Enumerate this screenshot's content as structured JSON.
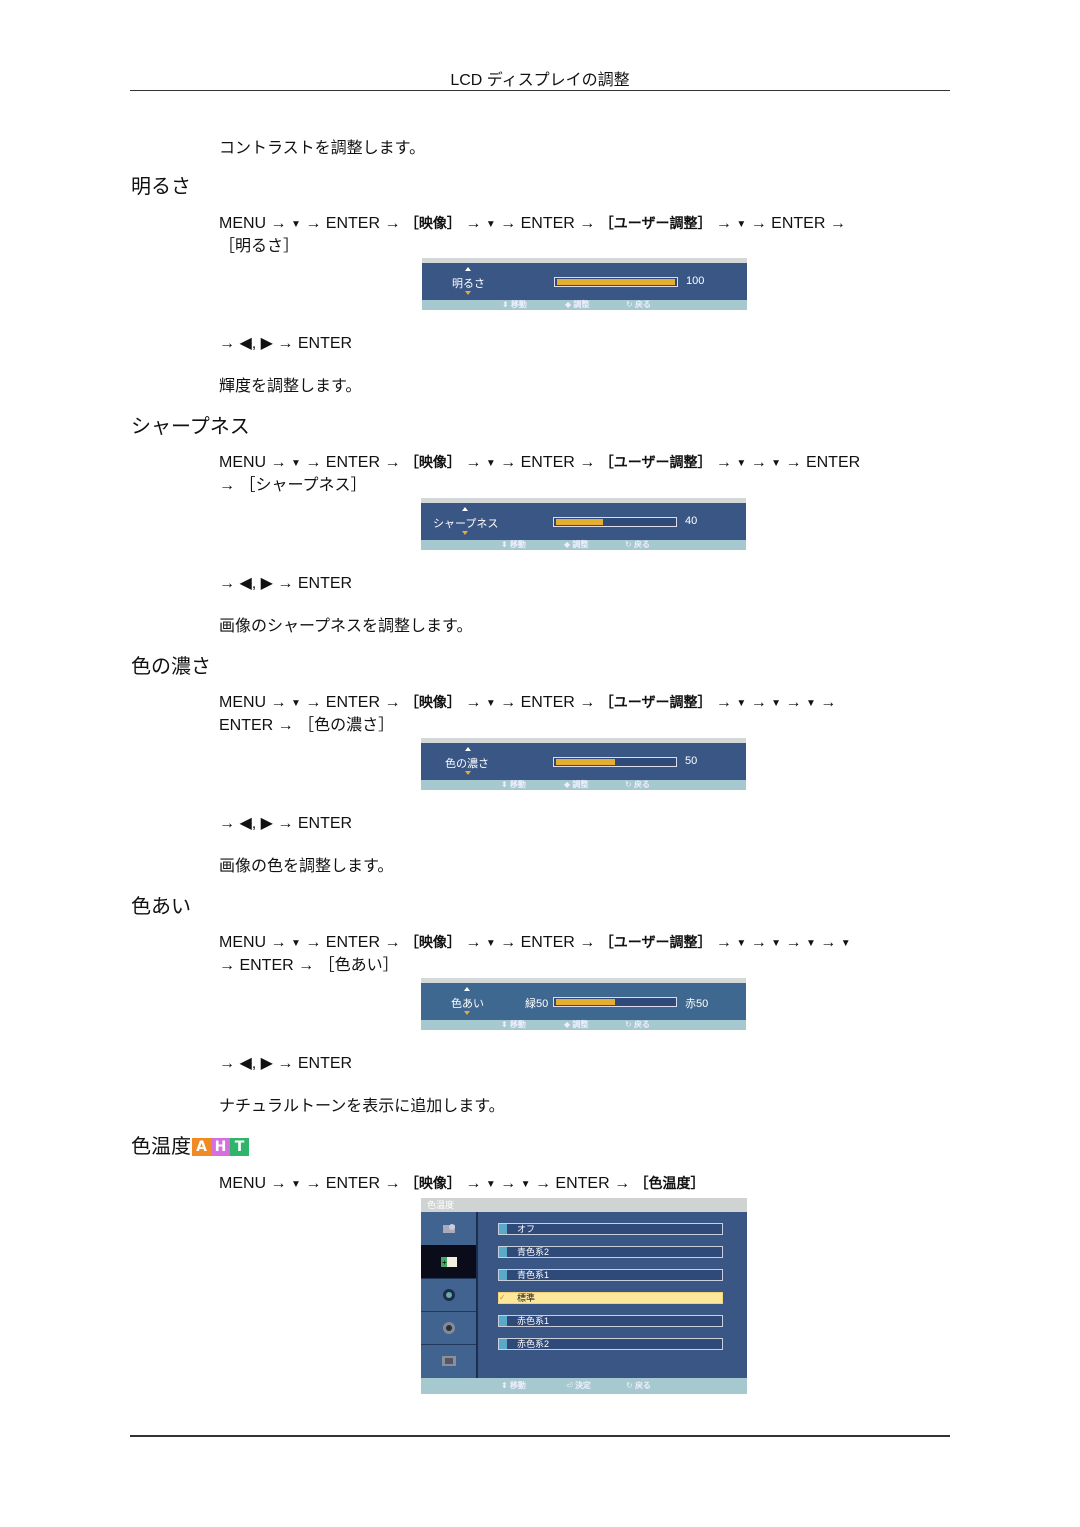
{
  "header": {
    "title": "LCD ディスプレイの調整"
  },
  "intro_text": "コントラストを調整します。",
  "arrows": {
    "right": "→",
    "down": "▼",
    "left_tri": "◀",
    "right_tri": "▶"
  },
  "sections": [
    {
      "title": "明るさ",
      "path_line1": [
        "MENU",
        "▼",
        "ENTER",
        "［映像］",
        "▼",
        "ENTER",
        "［ユーザー調整］",
        "▼",
        "ENTER"
      ],
      "path_line2_text": "［明るさ］",
      "osd": {
        "label": "明るさ",
        "value": "100",
        "fill_percent": 100
      },
      "nav": "→ ◀, ▶ → ENTER",
      "description": "輝度を調整します。"
    },
    {
      "title": "シャープネス",
      "path_line1": [
        "MENU",
        "▼",
        "ENTER",
        "［映像］",
        "▼",
        "ENTER",
        "［ユーザー調整］",
        "▼",
        "▼",
        "ENTER"
      ],
      "path_line2_text": "→ ［シャープネス］",
      "osd": {
        "label": "シャープネス",
        "value": "40",
        "fill_percent": 40
      },
      "nav": "→ ◀, ▶ → ENTER",
      "description": "画像のシャープネスを調整します。"
    },
    {
      "title": "色の濃さ",
      "path_line1": [
        "MENU",
        "▼",
        "ENTER",
        "［映像］",
        "▼",
        "ENTER",
        "［ユーザー調整］",
        "▼",
        "▼",
        "▼"
      ],
      "path_line2_text": "ENTER → ［色の濃さ］",
      "osd": {
        "label": "色の濃さ",
        "value": "50",
        "fill_percent": 50
      },
      "nav": "→ ◀, ▶ → ENTER",
      "description": "画像の色を調整します。"
    },
    {
      "title": "色あい",
      "path_line1": [
        "MENU",
        "▼",
        "ENTER",
        "［映像］",
        "▼",
        "ENTER",
        "［ユーザー調整］",
        "▼",
        "▼",
        "▼",
        "▼"
      ],
      "path_line2_text": "→ ENTER → ［色あい］",
      "osd": {
        "label": "色あい",
        "left_value": "緑50",
        "right_value": "赤50",
        "fill_percent": 50
      },
      "nav": "→ ◀, ▶ → ENTER",
      "description": "ナチュラルトーンを表示に追加します。"
    },
    {
      "title": "色温度",
      "badge": [
        "A",
        "H",
        "T"
      ],
      "badge_colors": [
        "#f08a24",
        "#d66ee0",
        "#2fb56a"
      ],
      "path_line1": [
        "MENU",
        "▼",
        "ENTER",
        "［映像］",
        "▼",
        "▼",
        "ENTER",
        "［色温度］"
      ]
    }
  ],
  "osd_footer": {
    "move": "移動",
    "adjust": "調整",
    "back": "戻る",
    "confirm": "決定"
  },
  "color_temp_menu": {
    "title": "色温度",
    "side_icons": [
      "picture-icon",
      "sound-icon",
      "setup-icon",
      "settings-icon",
      "input-icon"
    ],
    "selected_side_index": 1,
    "options": [
      "オフ",
      "青色系2",
      "青色系1",
      "標準",
      "赤色系1",
      "赤色系2"
    ],
    "selected_option": "標準",
    "check_mark": "✓"
  },
  "colors": {
    "osd_bg": "#3a5685",
    "osd_footer": "#a6c9cf",
    "osd_fill": "#e6ad33",
    "selected_option_bg": "#fde79a"
  }
}
